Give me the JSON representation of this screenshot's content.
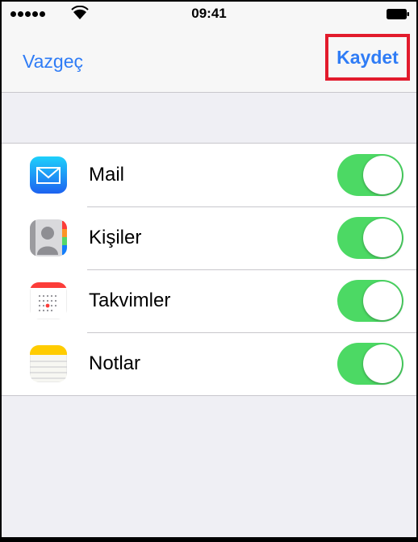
{
  "status_bar": {
    "time": "09:41",
    "signal_icon": "signal-dots-icon",
    "wifi_icon": "wifi-icon",
    "battery_icon": "battery-icon"
  },
  "nav": {
    "cancel_label": "Vazgeç",
    "save_label": "Kaydet",
    "accent_color": "#2f7cf6",
    "highlight_color": "#e21b2c"
  },
  "rows": [
    {
      "label": "Mail",
      "icon": "mail-app-icon",
      "enabled": true
    },
    {
      "label": "Kişiler",
      "icon": "contacts-app-icon",
      "enabled": true
    },
    {
      "label": "Takvimler",
      "icon": "calendar-app-icon",
      "enabled": true
    },
    {
      "label": "Notlar",
      "icon": "notes-app-icon",
      "enabled": true
    }
  ],
  "toggle_on_color": "#4cd964"
}
